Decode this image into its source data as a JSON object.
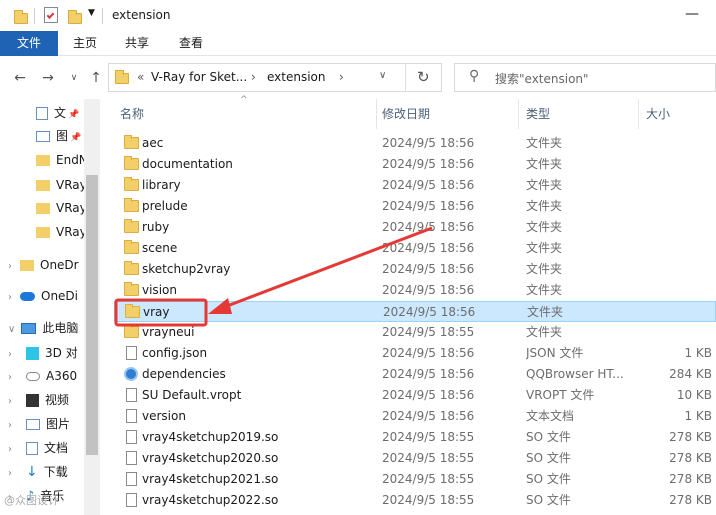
{
  "window": {
    "title": "extension",
    "minimize": "—"
  },
  "ribbon": {
    "tabs": [
      "文件",
      "主页",
      "共享",
      "查看"
    ]
  },
  "address": {
    "overflow": "«",
    "crumbs": [
      "V-Ray for Sket...",
      "extension"
    ],
    "search_placeholder": "搜索\"extension\""
  },
  "nav": {
    "items": [
      "文",
      "图",
      "EndN",
      "VRay",
      "VRay",
      "VRay",
      "OneDr",
      "OneDi",
      "此电脑",
      "3D 对",
      "A360",
      "视频",
      "图片",
      "文档",
      "下载",
      "音乐"
    ]
  },
  "columns": {
    "name": "名称",
    "date": "修改日期",
    "type": "类型",
    "size": "大小"
  },
  "files": [
    {
      "name": "aec",
      "date": "2024/9/5 18:56",
      "type": "文件夹",
      "size": "",
      "kind": "folder"
    },
    {
      "name": "documentation",
      "date": "2024/9/5 18:56",
      "type": "文件夹",
      "size": "",
      "kind": "folder"
    },
    {
      "name": "library",
      "date": "2024/9/5 18:56",
      "type": "文件夹",
      "size": "",
      "kind": "folder"
    },
    {
      "name": "prelude",
      "date": "2024/9/5 18:56",
      "type": "文件夹",
      "size": "",
      "kind": "folder"
    },
    {
      "name": "ruby",
      "date": "2024/9/5 18:56",
      "type": "文件夹",
      "size": "",
      "kind": "folder"
    },
    {
      "name": "scene",
      "date": "2024/9/5 18:56",
      "type": "文件夹",
      "size": "",
      "kind": "folder"
    },
    {
      "name": "sketchup2vray",
      "date": "2024/9/5 18:56",
      "type": "文件夹",
      "size": "",
      "kind": "folder"
    },
    {
      "name": "vision",
      "date": "2024/9/5 18:56",
      "type": "文件夹",
      "size": "",
      "kind": "folder"
    },
    {
      "name": "vray",
      "date": "2024/9/5 18:56",
      "type": "文件夹",
      "size": "",
      "kind": "folder"
    },
    {
      "name": "vrayneui",
      "date": "2024/9/5 18:55",
      "type": "文件夹",
      "size": "",
      "kind": "folder"
    },
    {
      "name": "config.json",
      "date": "2024/9/5 18:56",
      "type": "JSON 文件",
      "size": "1 KB",
      "kind": "file"
    },
    {
      "name": "dependencies",
      "date": "2024/9/5 18:56",
      "type": "QQBrowser HT...",
      "size": "284 KB",
      "kind": "qq"
    },
    {
      "name": "SU Default.vropt",
      "date": "2024/9/5 18:56",
      "type": "VROPT 文件",
      "size": "10 KB",
      "kind": "file"
    },
    {
      "name": "version",
      "date": "2024/9/5 18:56",
      "type": "文本文档",
      "size": "1 KB",
      "kind": "file"
    },
    {
      "name": "vray4sketchup2019.so",
      "date": "2024/9/5 18:55",
      "type": "SO 文件",
      "size": "278 KB",
      "kind": "file"
    },
    {
      "name": "vray4sketchup2020.so",
      "date": "2024/9/5 18:55",
      "type": "SO 文件",
      "size": "278 KB",
      "kind": "file"
    },
    {
      "name": "vray4sketchup2021.so",
      "date": "2024/9/5 18:55",
      "type": "SO 文件",
      "size": "278 KB",
      "kind": "file"
    },
    {
      "name": "vray4sketchup2022.so",
      "date": "2024/9/5 18:55",
      "type": "SO 文件",
      "size": "278 KB",
      "kind": "file"
    }
  ],
  "selected_index": 8,
  "colors": {
    "accent": "#1e63b4",
    "selection": "#cce8ff",
    "annotation": "#e53935"
  },
  "watermark": "@众图设计"
}
